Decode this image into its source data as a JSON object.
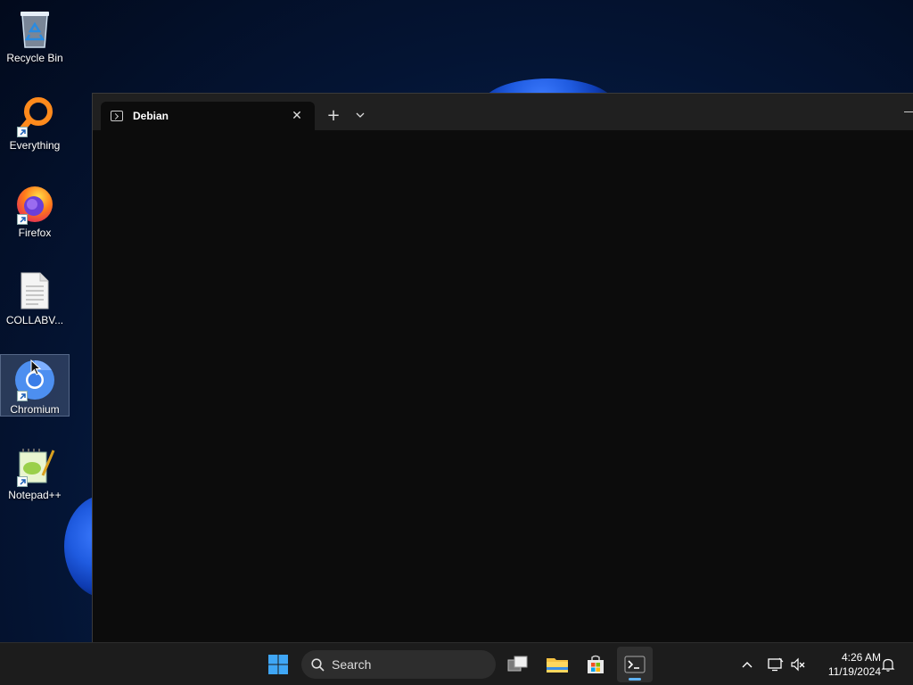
{
  "desktop": {
    "icons": [
      {
        "label": "Recycle Bin",
        "icon": "recycle-bin-icon"
      },
      {
        "label": "Everything",
        "icon": "everything-search-icon"
      },
      {
        "label": "Firefox",
        "icon": "firefox-icon"
      },
      {
        "label": "COLLABV...",
        "icon": "text-document-icon"
      },
      {
        "label": "Chromium",
        "icon": "chromium-icon"
      },
      {
        "label": "Notepad++",
        "icon": "notepad-plus-plus-icon"
      }
    ]
  },
  "terminal": {
    "tab_title": "Debian",
    "new_tab_glyph": "+",
    "close_glyph": "✕"
  },
  "taskbar": {
    "search_placeholder": "Search",
    "clock_time": "4:26 AM",
    "clock_date": "11/19/2024"
  },
  "colors": {
    "terminal_bg": "#0c0c0c",
    "titlebar_bg": "#202020",
    "taskbar_bg": "#1c1c1c",
    "accent_blue": "#5fb2f2"
  }
}
